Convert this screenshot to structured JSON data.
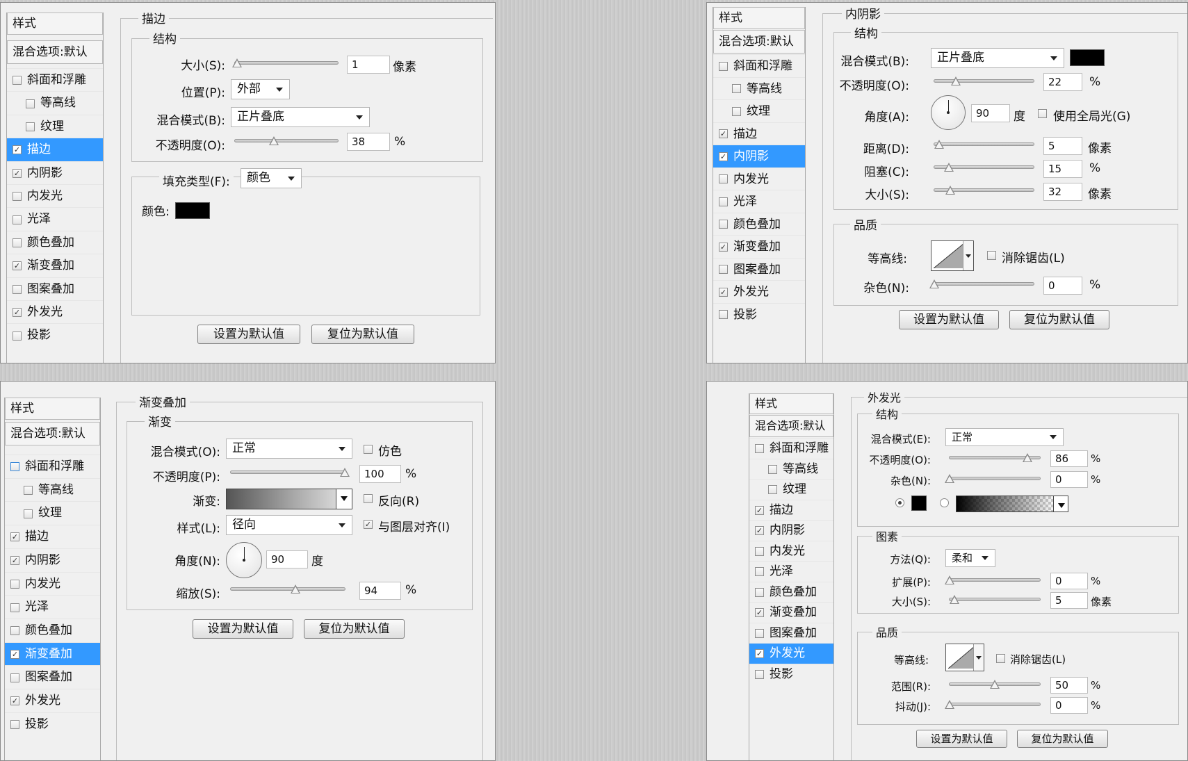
{
  "common": {
    "sidebar_title": "样式",
    "blend_default": "混合选项:默认",
    "btn_default": "设置为默认值",
    "btn_reset": "复位为默认值"
  },
  "panel1": {
    "title": "描边",
    "structure": "结构",
    "size_label": "大小(S):",
    "size_value": "1",
    "size_unit": "像素",
    "size_level": 0.02,
    "position_label": "位置(P):",
    "position_value": "外部",
    "blend_label": "混合模式(B):",
    "blend_value": "正片叠底",
    "opacity_label": "不透明度(O):",
    "opacity_value": "38",
    "opacity_unit": "%",
    "opacity_level": 0.38,
    "fill_type_label": "填充类型(F):",
    "fill_type_value": "颜色",
    "color_label": "颜色:",
    "color_hex": "#000000",
    "items": [
      {
        "label": "斜面和浮雕",
        "checked": false,
        "indent": false
      },
      {
        "label": "等高线",
        "checked": false,
        "indent": true
      },
      {
        "label": "纹理",
        "checked": false,
        "indent": true
      },
      {
        "label": "描边",
        "checked": true,
        "indent": false,
        "selected": true
      },
      {
        "label": "内阴影",
        "checked": true,
        "indent": false
      },
      {
        "label": "内发光",
        "checked": false,
        "indent": false
      },
      {
        "label": "光泽",
        "checked": false,
        "indent": false
      },
      {
        "label": "颜色叠加",
        "checked": false,
        "indent": false
      },
      {
        "label": "渐变叠加",
        "checked": true,
        "indent": false
      },
      {
        "label": "图案叠加",
        "checked": false,
        "indent": false
      },
      {
        "label": "外发光",
        "checked": true,
        "indent": false
      },
      {
        "label": "投影",
        "checked": false,
        "indent": false
      }
    ]
  },
  "panel2": {
    "title": "内阴影",
    "structure": "结构",
    "blend_label": "混合模式(B):",
    "blend_value": "正片叠底",
    "blend_color": "#000000",
    "opacity_label": "不透明度(O):",
    "opacity_value": "22",
    "opacity_unit": "%",
    "opacity_level": 0.22,
    "angle_label": "角度(A):",
    "angle_value": "90",
    "angle_unit": "度",
    "global_light_label": "使用全局光(G)",
    "global_light_checked": false,
    "distance_label": "距离(D):",
    "distance_value": "5",
    "distance_unit": "像素",
    "distance_level": 0.05,
    "choke_label": "阻塞(C):",
    "choke_value": "15",
    "choke_unit": "%",
    "choke_level": 0.15,
    "size_label": "大小(S):",
    "size_value": "32",
    "size_unit": "像素",
    "size_level": 0.16,
    "quality": "品质",
    "contour_label": "等高线:",
    "antialias_label": "消除锯齿(L)",
    "antialias_checked": false,
    "noise_label": "杂色(N):",
    "noise_value": "0",
    "noise_unit": "%",
    "noise_level": 0,
    "items": [
      {
        "label": "斜面和浮雕",
        "checked": false,
        "indent": false
      },
      {
        "label": "等高线",
        "checked": false,
        "indent": true
      },
      {
        "label": "纹理",
        "checked": false,
        "indent": true
      },
      {
        "label": "描边",
        "checked": true,
        "indent": false
      },
      {
        "label": "内阴影",
        "checked": true,
        "indent": false,
        "selected": true
      },
      {
        "label": "内发光",
        "checked": false,
        "indent": false
      },
      {
        "label": "光泽",
        "checked": false,
        "indent": false
      },
      {
        "label": "颜色叠加",
        "checked": false,
        "indent": false
      },
      {
        "label": "渐变叠加",
        "checked": true,
        "indent": false
      },
      {
        "label": "图案叠加",
        "checked": false,
        "indent": false
      },
      {
        "label": "外发光",
        "checked": true,
        "indent": false
      },
      {
        "label": "投影",
        "checked": false,
        "indent": false
      }
    ]
  },
  "panel3": {
    "title": "渐变叠加",
    "section": "渐变",
    "blend_label": "混合模式(O):",
    "blend_value": "正常",
    "dither_label": "仿色",
    "dither_checked": false,
    "opacity_label": "不透明度(P):",
    "opacity_value": "100",
    "opacity_unit": "%",
    "opacity_level": 1.0,
    "gradient_label": "渐变:",
    "reverse_label": "反向(R)",
    "reverse_checked": false,
    "style_label": "样式(L):",
    "style_value": "径向",
    "align_label": "与图层对齐(I)",
    "align_checked": true,
    "angle_label": "角度(N):",
    "angle_value": "90",
    "angle_unit": "度",
    "scale_label": "缩放(S):",
    "scale_value": "94",
    "scale_unit": "%",
    "scale_level": 0.57,
    "items": [
      {
        "label": "斜面和浮雕",
        "checked": false,
        "indent": false,
        "blue": true
      },
      {
        "label": "等高线",
        "checked": false,
        "indent": true
      },
      {
        "label": "纹理",
        "checked": false,
        "indent": true
      },
      {
        "label": "描边",
        "checked": true,
        "indent": false
      },
      {
        "label": "内阴影",
        "checked": true,
        "indent": false
      },
      {
        "label": "内发光",
        "checked": false,
        "indent": false
      },
      {
        "label": "光泽",
        "checked": false,
        "indent": false
      },
      {
        "label": "颜色叠加",
        "checked": false,
        "indent": false
      },
      {
        "label": "渐变叠加",
        "checked": true,
        "indent": false,
        "selected": true
      },
      {
        "label": "图案叠加",
        "checked": false,
        "indent": false
      },
      {
        "label": "外发光",
        "checked": true,
        "indent": false
      },
      {
        "label": "投影",
        "checked": false,
        "indent": false
      }
    ]
  },
  "panel4": {
    "title": "外发光",
    "structure": "结构",
    "blend_label": "混合模式(E):",
    "blend_value": "正常",
    "opacity_label": "不透明度(O):",
    "opacity_value": "86",
    "opacity_unit": "%",
    "opacity_level": 0.86,
    "noise_label": "杂色(N):",
    "noise_value": "0",
    "noise_unit": "%",
    "noise_level": 0,
    "glow_color": "#000000",
    "elements": "图素",
    "method_label": "方法(Q):",
    "method_value": "柔和",
    "spread_label": "扩展(P):",
    "spread_value": "0",
    "spread_unit": "%",
    "spread_level": 0,
    "size_label": "大小(S):",
    "size_value": "5",
    "size_unit": "像素",
    "size_level": 0.05,
    "quality": "品质",
    "contour_label": "等高线:",
    "antialias_label": "消除锯齿(L)",
    "antialias_checked": false,
    "range_label": "范围(R):",
    "range_value": "50",
    "range_unit": "%",
    "range_level": 0.5,
    "jitter_label": "抖动(J):",
    "jitter_value": "0",
    "jitter_unit": "%",
    "jitter_level": 0,
    "items": [
      {
        "label": "斜面和浮雕",
        "checked": false,
        "indent": false
      },
      {
        "label": "等高线",
        "checked": false,
        "indent": true
      },
      {
        "label": "纹理",
        "checked": false,
        "indent": true
      },
      {
        "label": "描边",
        "checked": true,
        "indent": false
      },
      {
        "label": "内阴影",
        "checked": true,
        "indent": false
      },
      {
        "label": "内发光",
        "checked": false,
        "indent": false
      },
      {
        "label": "光泽",
        "checked": false,
        "indent": false
      },
      {
        "label": "颜色叠加",
        "checked": false,
        "indent": false
      },
      {
        "label": "渐变叠加",
        "checked": true,
        "indent": false
      },
      {
        "label": "图案叠加",
        "checked": false,
        "indent": false
      },
      {
        "label": "外发光",
        "checked": true,
        "indent": false,
        "selected": true
      },
      {
        "label": "投影",
        "checked": false,
        "indent": false
      }
    ]
  }
}
